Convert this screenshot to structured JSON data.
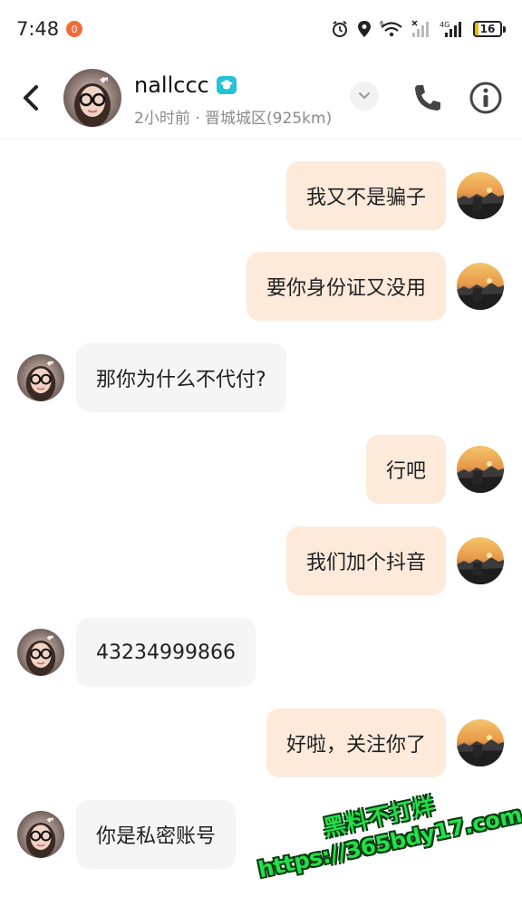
{
  "status_bar": {
    "time": "7:48",
    "notification_count": "0",
    "battery_level": "16",
    "battery_fraction": 0.16,
    "network_label": "4G",
    "wifi_label": "6",
    "icons": [
      "alarm-icon",
      "location-icon",
      "wifi-icon",
      "signal-icon",
      "battery-icon"
    ]
  },
  "header": {
    "contact_name": "nallccc",
    "subtitle": "2小时前 · 晋城城区(925km)",
    "icons": [
      "back-icon",
      "verified-badge-icon",
      "chevron-down-icon",
      "phone-icon",
      "info-icon"
    ]
  },
  "messages": [
    {
      "direction": "out",
      "text": "我又不是骗子"
    },
    {
      "direction": "out",
      "text": "要你身份证又没用"
    },
    {
      "direction": "in",
      "text": "那你为什么不代付?"
    },
    {
      "direction": "out",
      "text": "行吧"
    },
    {
      "direction": "out",
      "text": "我们加个抖音"
    },
    {
      "direction": "in",
      "text": "43234999866"
    },
    {
      "direction": "out",
      "text": "好啦，关注你了"
    },
    {
      "direction": "in",
      "text": "你是私密账号"
    }
  ],
  "watermark": {
    "line1": "黑料不打烊",
    "line2": "https://365bdy17.com"
  },
  "colors": {
    "outgoing_bubble": "#fdeadb",
    "incoming_bubble": "#f5f5f5",
    "notification_badge": "#f26a3b",
    "verified_badge": "#25c2d8",
    "watermark_green": "#22e04a"
  }
}
